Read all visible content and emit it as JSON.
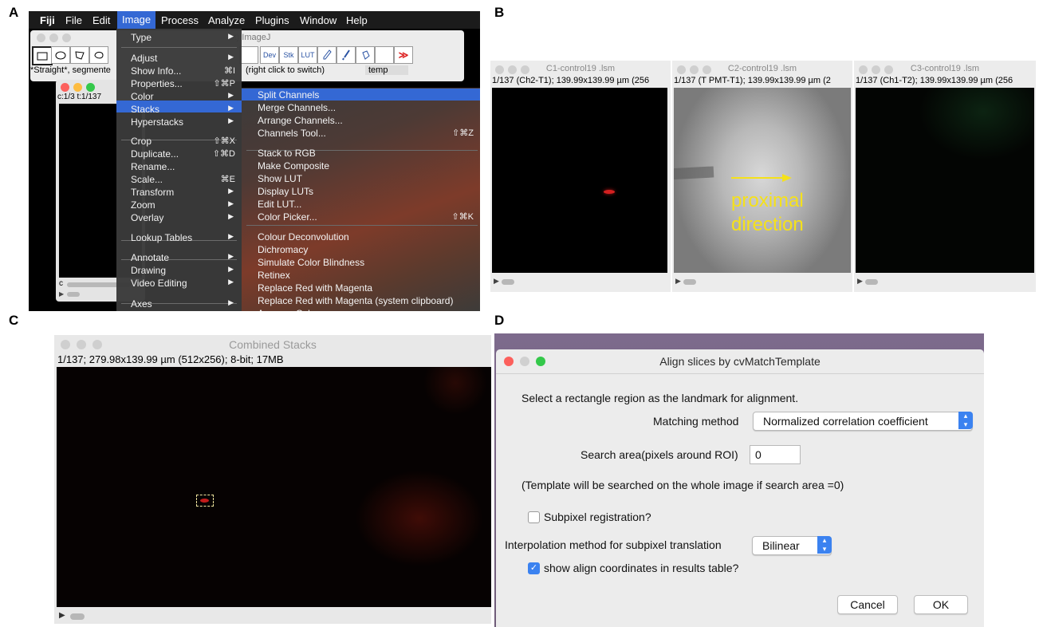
{
  "panels": {
    "a": "A",
    "b": "B",
    "c": "C",
    "d": "D"
  },
  "panel_a": {
    "menubar": [
      "Fiji",
      "File",
      "Edit",
      "Image",
      "Process",
      "Analyze",
      "Plugins",
      "Window",
      "Help"
    ],
    "toolbar_title_fragment": "st) ImageJ",
    "tool_labels": {
      "dev": "Dev",
      "stk": "Stk",
      "lut": "LUT",
      "more": "≫"
    },
    "status_left": "*Straight*, segmente",
    "status_right": "(right click to switch)",
    "status_field": "temp",
    "image_window_info": "c:1/3 t:1/137",
    "image_window_scroll_label": "c",
    "image_menu": [
      {
        "label": "Type",
        "arrow": "▶"
      },
      {
        "label": "Adjust",
        "arrow": "▶"
      },
      {
        "label": "Show Info...",
        "shortcut": "⌘I"
      },
      {
        "label": "Properties...",
        "shortcut": "⇧⌘P"
      },
      {
        "label": "Color",
        "arrow": "▶"
      },
      {
        "label": "Stacks",
        "arrow": "▶"
      },
      {
        "label": "Hyperstacks",
        "arrow": "▶"
      },
      {
        "label": "Crop",
        "shortcut": "⇧⌘X"
      },
      {
        "label": "Duplicate...",
        "shortcut": "⇧⌘D"
      },
      {
        "label": "Rename..."
      },
      {
        "label": "Scale...",
        "shortcut": "⌘E"
      },
      {
        "label": "Transform",
        "arrow": "▶"
      },
      {
        "label": "Zoom",
        "arrow": "▶"
      },
      {
        "label": "Overlay",
        "arrow": "▶"
      },
      {
        "label": "Lookup Tables",
        "arrow": "▶"
      },
      {
        "label": "Annotate",
        "arrow": "▶"
      },
      {
        "label": "Drawing",
        "arrow": "▶"
      },
      {
        "label": "Video Editing",
        "arrow": "▶"
      },
      {
        "label": "Axes",
        "arrow": "▶"
      }
    ],
    "color_submenu": [
      {
        "label": "Split Channels"
      },
      {
        "label": "Merge Channels..."
      },
      {
        "label": "Arrange Channels..."
      },
      {
        "label": "Channels Tool...",
        "shortcut": "⇧⌘Z"
      },
      {
        "label": "Stack to RGB"
      },
      {
        "label": "Make Composite"
      },
      {
        "label": "Show LUT"
      },
      {
        "label": "Display LUTs"
      },
      {
        "label": "Edit LUT..."
      },
      {
        "label": "Color Picker...",
        "shortcut": "⇧⌘K"
      },
      {
        "label": "Colour Deconvolution"
      },
      {
        "label": "Dichromacy"
      },
      {
        "label": "Simulate Color Blindness"
      },
      {
        "label": "Retinex"
      },
      {
        "label": "Replace Red with Magenta"
      },
      {
        "label": "Replace Red with Magenta (system clipboard)"
      },
      {
        "label": "Average Color"
      }
    ]
  },
  "panel_b": {
    "windows": [
      {
        "title": "C1-control19 .lsm",
        "info": "1/137 (Ch2-T1); 139.99x139.99 µm (256"
      },
      {
        "title": "C2-control19 .lsm",
        "info": "1/137 (T PMT-T1); 139.99x139.99 µm (2"
      },
      {
        "title": "C3-control19 .lsm",
        "info": "1/137 (Ch1-T2); 139.99x139.99 µm (256"
      }
    ],
    "annotation_line1": "proximal",
    "annotation_line2": "direction",
    "annotation_color": "#f5e11a"
  },
  "panel_c": {
    "title": "Combined Stacks",
    "info": "1/137; 279.98x139.99 µm (512x256); 8-bit; 17MB"
  },
  "panel_d": {
    "title": "Align slices by cvMatchTemplate",
    "instruction": "Select a rectangle region as the landmark for alignment.",
    "matching_label": "Matching method",
    "matching_value": "Normalized correlation coefficient",
    "search_label": "Search area(pixels around ROI)",
    "search_value": "0",
    "note": "(Template will be searched on the whole image if search area =0)",
    "subpixel_label": "Subpixel registration?",
    "subpixel_checked": false,
    "interp_label": "Interpolation method for subpixel translation",
    "interp_value": "Bilinear",
    "show_coords_label": "show align coordinates in results table?",
    "show_coords_checked": true,
    "cancel_label": "Cancel",
    "ok_label": "OK"
  }
}
